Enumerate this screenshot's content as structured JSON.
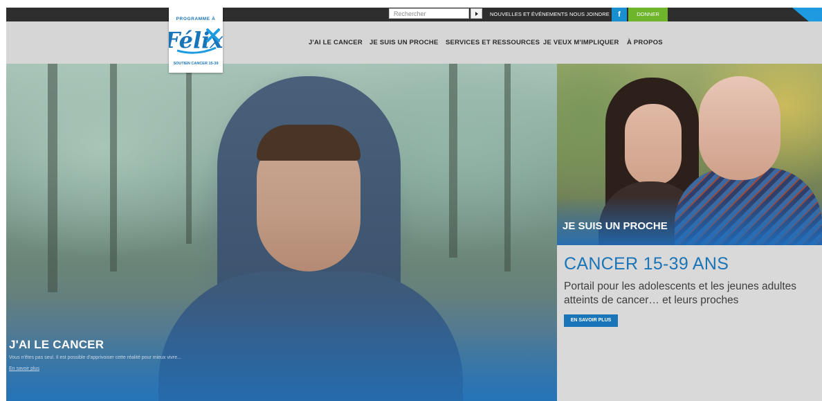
{
  "topbar": {
    "search": {
      "placeholder": "Rechercher",
      "value": ""
    },
    "links": {
      "news": "NOUVELLES ET ÉVÉNEMENTS",
      "contact": "NOUS JOINDRE",
      "facebook": "f",
      "donate": "DONNER"
    },
    "colors": {
      "facebook": "#1a8fd0",
      "donate": "#6fb52c",
      "corner": "#1e9be0"
    }
  },
  "logo": {
    "top_text": "PROGRAMME À",
    "name": "Félix",
    "bottom_text": "SOUTIEN CANCER 15-39"
  },
  "nav": {
    "items": [
      "J'AI LE CANCER",
      "JE SUIS UN PROCHE",
      "SERVICES ET RESSOURCES",
      "JE VEUX M'IMPLIQUER",
      "À PROPOS"
    ]
  },
  "hero_left": {
    "title": "J'AI LE CANCER",
    "text": "Vous n'êtes pas seul. Il est possible d'apprivoiser cette réalité pour mieux vivre...",
    "link": "En savoir plus"
  },
  "hero_right": {
    "title": "JE SUIS UN PROCHE",
    "heading": "CANCER 15-39 ANS",
    "text": "Portail pour les adolescents et les jeunes adultes atteints de cancer… et leurs proches",
    "button": "EN SAVOIR PLUS"
  },
  "accent_color": "#1a74b8"
}
